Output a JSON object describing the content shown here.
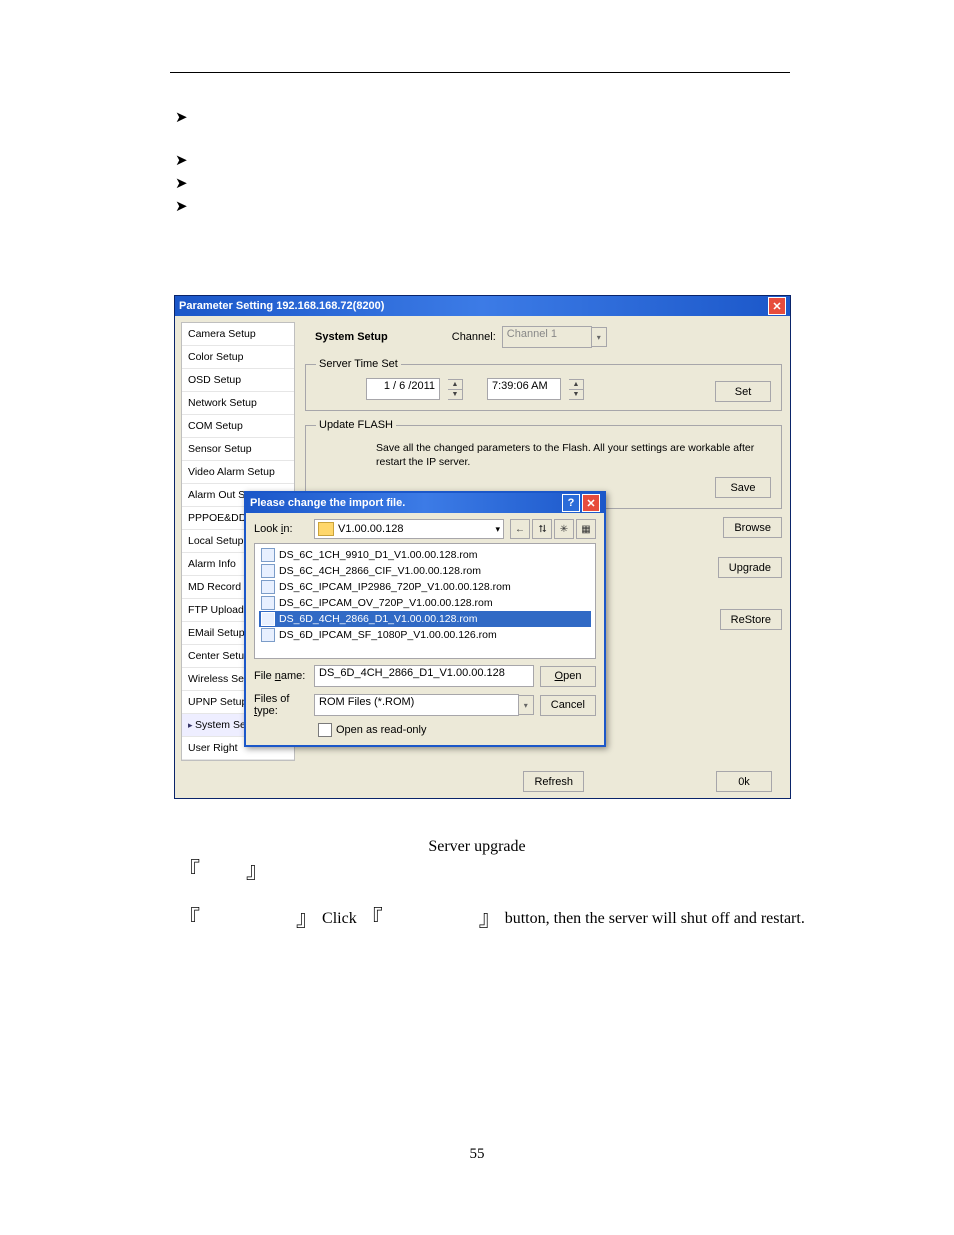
{
  "page_number": "55",
  "bullets": [
    "",
    "",
    "",
    ""
  ],
  "window": {
    "title": "Parameter Setting 192.168.168.72(8200)",
    "close_label": "✕",
    "sidebar": {
      "items": [
        "Camera Setup",
        "Color Setup",
        "OSD Setup",
        "Network Setup",
        "COM Setup",
        "Sensor Setup",
        "Video Alarm Setup",
        "Alarm Out Setup",
        "PPPOE&DDNS",
        "Local Setup",
        "Alarm Info",
        "MD Record",
        "FTP Upload",
        "EMail Setup",
        "Center Setup",
        "Wireless Setup",
        "UPNP Setup",
        "System Setup",
        "User Right"
      ],
      "active_index": 17
    },
    "header": {
      "title": "System Setup",
      "channel_label": "Channel:",
      "channel_value": "Channel 1"
    },
    "groups": {
      "server_time": {
        "legend": "Server Time Set",
        "date": "1 / 6 /2011",
        "time": "7:39:06 AM",
        "set_btn": "Set"
      },
      "flash": {
        "legend": "Update FLASH",
        "text": "Save all the changed parameters to the Flash. All your settings are workable after restart the IP server.",
        "save_btn": "Save"
      },
      "upgrade_hidden": {
        "browse_btn": "Browse",
        "upgrade_btn": "Upgrade"
      },
      "restore_hidden": {
        "restore_btn": "ReStore"
      }
    },
    "footer": {
      "refresh": "Refresh",
      "ok": "0k"
    }
  },
  "file_dialog": {
    "title": "Please change the import file.",
    "help_label": "?",
    "close_label": "✕",
    "lookin_label_pre": "Look ",
    "lookin_label_u": "i",
    "lookin_label_post": "n:",
    "lookin_value": "V1.00.00.128",
    "toolbar_icons": [
      "back-icon",
      "up-icon",
      "new-folder-icon",
      "views-icon"
    ],
    "toolbar_glyphs": [
      "←",
      "⮁",
      "✳",
      "▦"
    ],
    "files": [
      "DS_6C_1CH_9910_D1_V1.00.00.128.rom",
      "DS_6C_4CH_2866_CIF_V1.00.00.128.rom",
      "DS_6C_IPCAM_IP2986_720P_V1.00.00.128.rom",
      "DS_6C_IPCAM_OV_720P_V1.00.00.128.rom",
      "DS_6D_4CH_2866_D1_V1.00.00.128.rom",
      "DS_6D_IPCAM_SF_1080P_V1.00.00.126.rom"
    ],
    "selected_index": 4,
    "filename_label_pre": "File ",
    "filename_label_u": "n",
    "filename_label_post": "ame:",
    "filename_value": "DS_6D_4CH_2866_D1_V1.00.00.128",
    "filetype_label_pre": "Files of ",
    "filetype_label_u": "t",
    "filetype_label_post": "ype:",
    "filetype_value": "ROM Files (*.ROM)",
    "readonly_label": "Open as read-only",
    "open_btn_u": "O",
    "open_btn_post": "pen",
    "cancel_btn": "Cancel"
  },
  "chart_data": null,
  "caption": "Server upgrade",
  "line2_click": "Click",
  "line2_tail": "button, then the server will shut off and restart."
}
